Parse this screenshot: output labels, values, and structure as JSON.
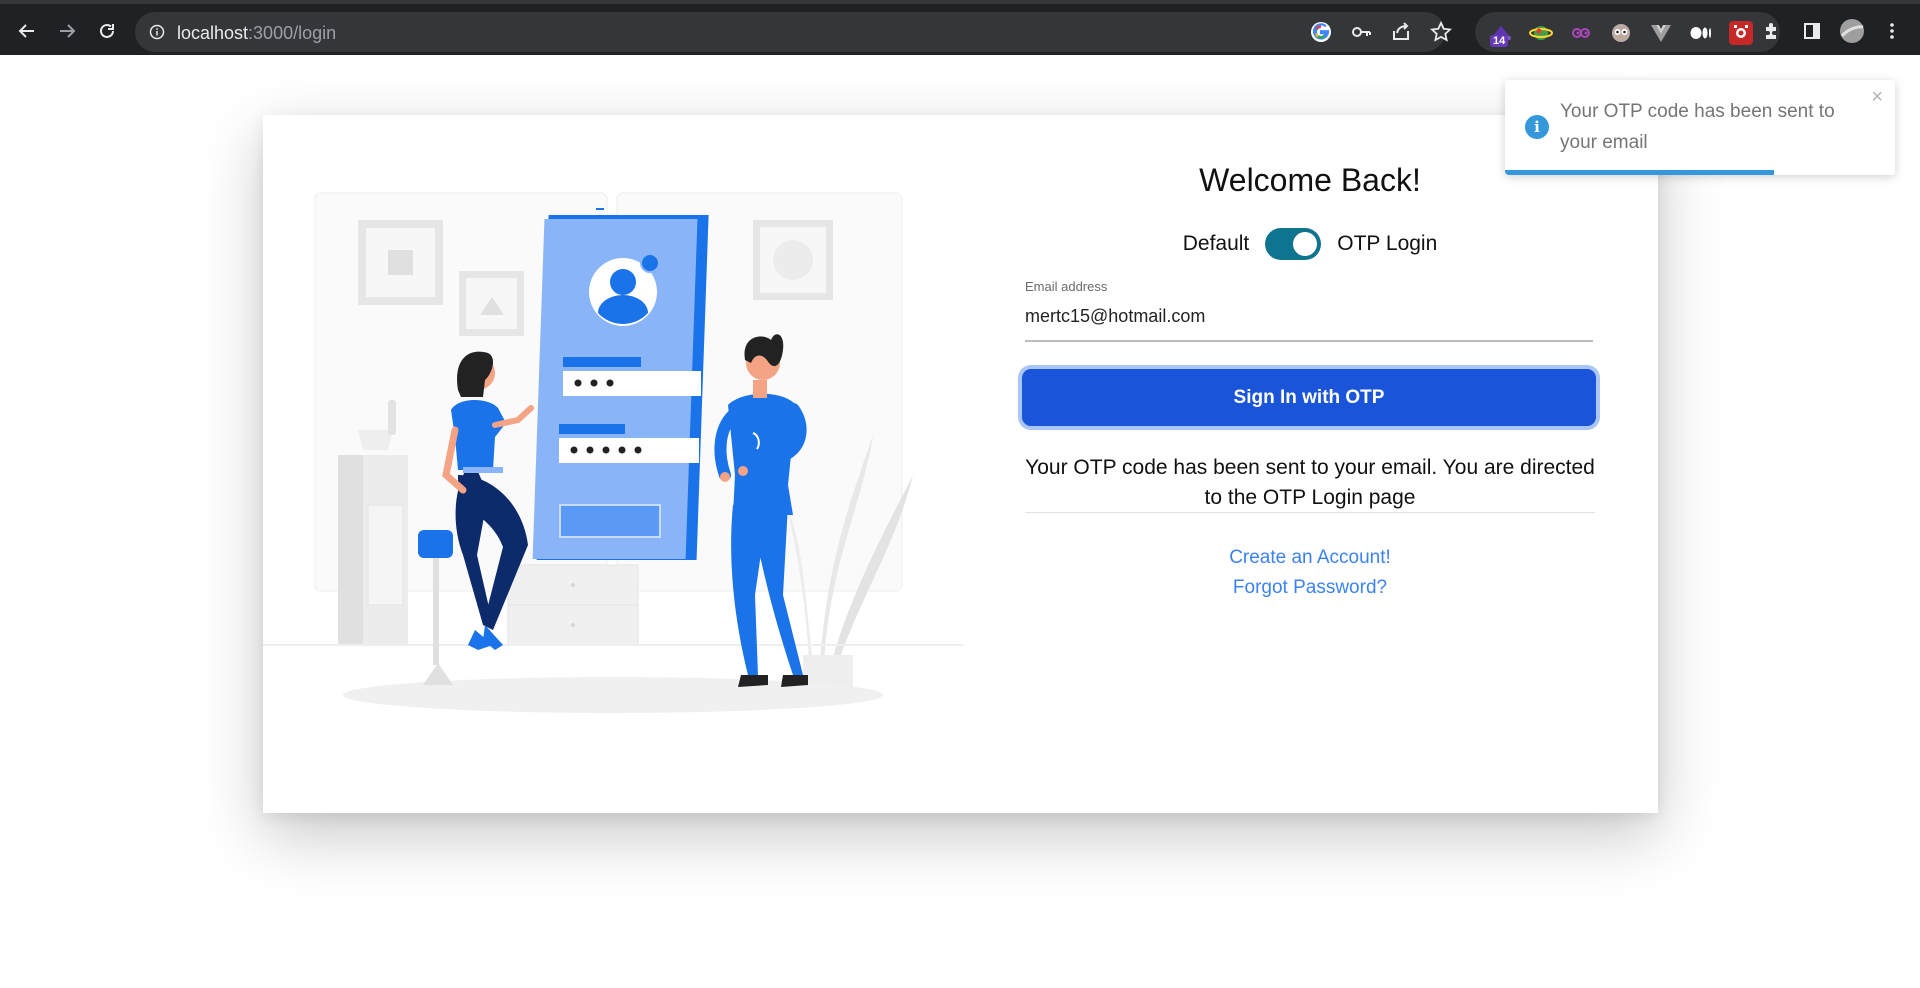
{
  "browser": {
    "url_host": "localhost",
    "url_path": ":3000/login",
    "extension_badge": "14",
    "icons": [
      "back-icon",
      "forward-icon",
      "reload-icon",
      "info-icon",
      "google-icon",
      "key-icon",
      "share-icon",
      "star-icon",
      "extensions-icon",
      "side-panel-icon",
      "profile-avatar",
      "menu-icon"
    ]
  },
  "login": {
    "title": "Welcome Back!",
    "toggle_left": "Default",
    "toggle_right": "OTP Login",
    "toggle_on": true,
    "email_label": "Email address",
    "email_value": "mertc15@hotmail.com",
    "submit_label": "Sign In with OTP",
    "message": "Your OTP code has been sent to your email. You are directed to the OTP Login page",
    "create_account": "Create an Account!",
    "forgot_password": "Forgot Password?"
  },
  "toast": {
    "message": "Your OTP code has been sent to your email",
    "close": "×",
    "info": "i",
    "progress": 0.69
  },
  "colors": {
    "primary_button": "#1a55d9",
    "toggle": "#0e7490",
    "link": "#3b82f6",
    "toast_accent": "#3498db"
  }
}
